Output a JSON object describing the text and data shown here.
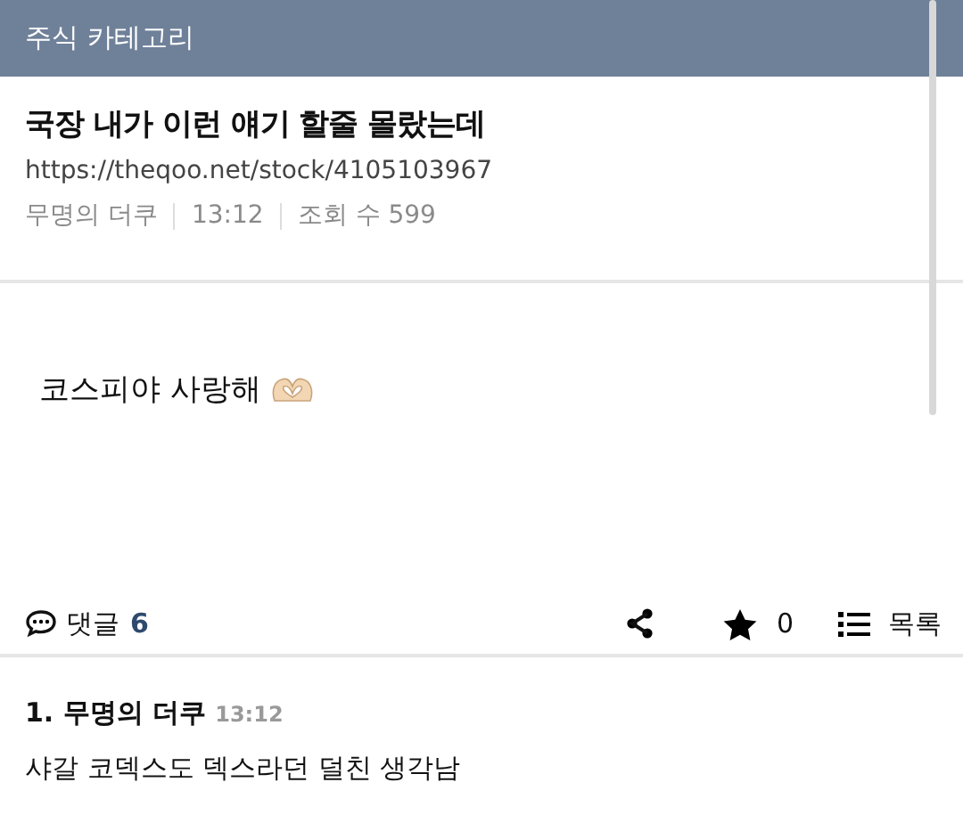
{
  "header": {
    "title": "주식 카테고리"
  },
  "post": {
    "title": "국장 내가 이런 얘기 할줄 몰랐는데",
    "url": "https://theqoo.net/stock/4105103967",
    "author": "무명의 더쿠",
    "time": "13:12",
    "views": "조회 수 599",
    "body": "코스피야 사랑해"
  },
  "actions": {
    "comments_label": "댓글",
    "comments_count": "6",
    "star_count": "0",
    "list_label": "목록"
  },
  "comments": [
    {
      "number": "1.",
      "author": "무명의 더쿠",
      "time": "13:12",
      "text": "샤갈 코덱스도 덱스라던 덜친 생각남"
    }
  ]
}
